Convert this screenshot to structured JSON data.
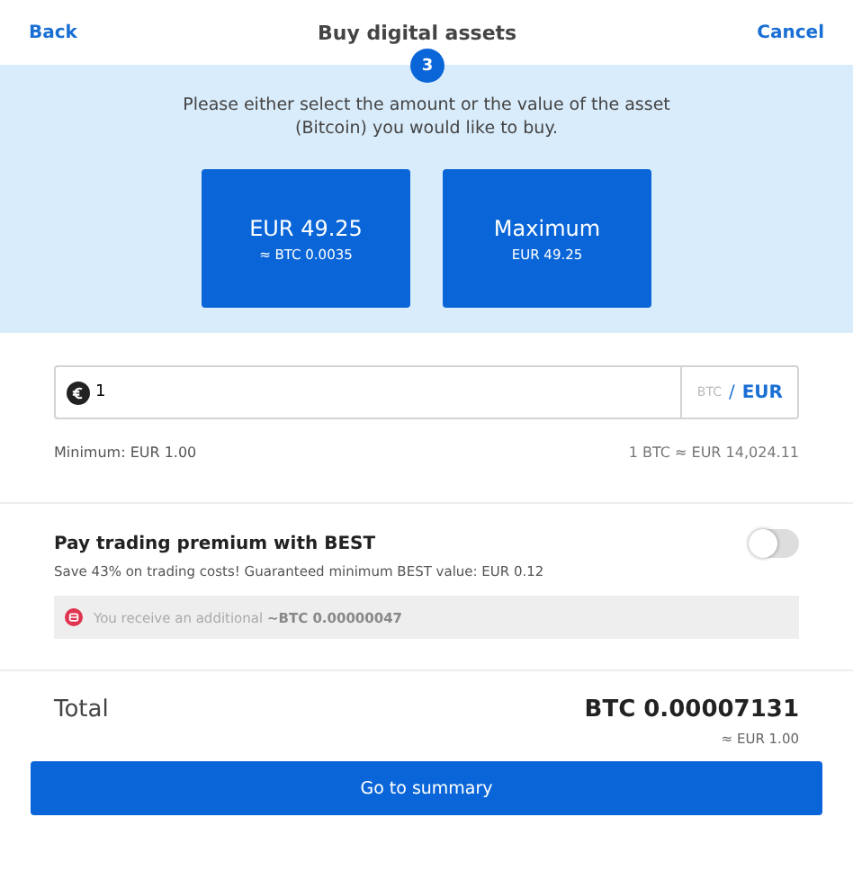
{
  "header": {
    "back": "Back",
    "title": "Buy digital assets",
    "cancel": "Cancel",
    "step": "3"
  },
  "prompt": "Please either select the amount or the value of the asset (Bitcoin) you would like to buy.",
  "options": [
    {
      "main": "EUR 49.25",
      "sub": "≈ BTC 0.0035"
    },
    {
      "main": "Maximum",
      "sub": "EUR 49.25"
    }
  ],
  "amount": {
    "value": "1",
    "separator": "/",
    "units": [
      {
        "label": "BTC",
        "selected": false
      },
      {
        "label": "EUR",
        "selected": true
      }
    ]
  },
  "minimum": "Minimum: EUR 1.00",
  "rate": "1 BTC ≈ EUR 14,024.11",
  "premium": {
    "title": "Pay trading premium with BEST",
    "on": false,
    "description": "Save 43% on trading costs! Guaranteed minimum BEST value: EUR 0.12",
    "note": "You receive an additional **~BTC 0.00000047**"
  },
  "total": {
    "label": "Total",
    "value": "BTC 0.00007131",
    "sub": "≈ EUR 1.00"
  },
  "submit": "Go to summary"
}
